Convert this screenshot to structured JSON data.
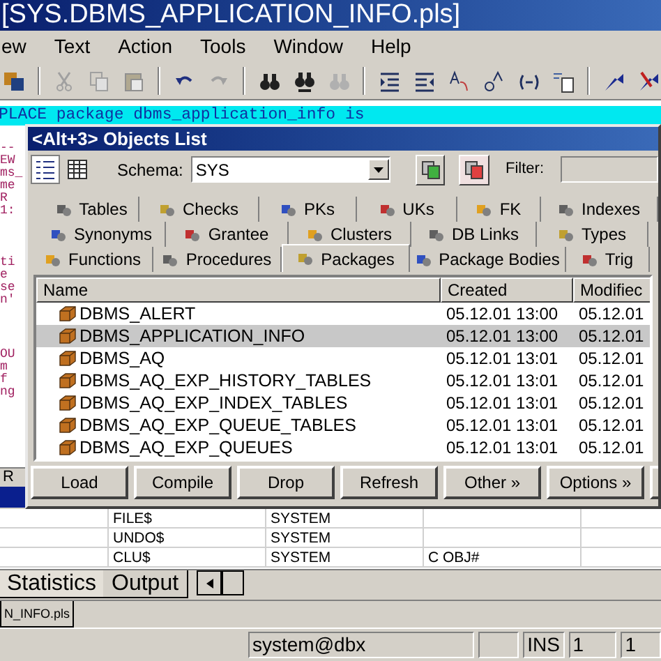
{
  "window": {
    "title": "[SYS.DBMS_APPLICATION_INFO.pls]"
  },
  "menu": [
    "ew",
    "Text",
    "Action",
    "Tools",
    "Window",
    "Help"
  ],
  "editor": {
    "current_line": "PLACE package dbms_application_info is",
    "fragments": [
      "--",
      "EW",
      "ms_",
      "me",
      "R",
      "1:",
      "ti",
      "e",
      "se",
      "n'",
      "OU",
      "m",
      "f",
      "ng"
    ]
  },
  "side_panel": {
    "label": "R"
  },
  "objects_list": {
    "title": "<Alt+3> Objects List",
    "schema_label": "Schema:",
    "schema_value": "SYS",
    "filter_label": "Filter:",
    "tab_rows": [
      [
        {
          "label": "Tables",
          "selected": false
        },
        {
          "label": "Checks",
          "selected": false
        },
        {
          "label": "PKs",
          "selected": false
        },
        {
          "label": "UKs",
          "selected": false
        },
        {
          "label": "FK",
          "selected": false
        },
        {
          "label": "Indexes",
          "selected": false
        }
      ],
      [
        {
          "label": "Synonyms",
          "selected": false
        },
        {
          "label": "Grantee",
          "selected": false
        },
        {
          "label": "Clusters",
          "selected": false
        },
        {
          "label": "DB Links",
          "selected": false
        },
        {
          "label": "Types",
          "selected": false
        }
      ],
      [
        {
          "label": "Functions",
          "selected": false
        },
        {
          "label": "Procedures",
          "selected": false
        },
        {
          "label": "Packages",
          "selected": true
        },
        {
          "label": "Package Bodies",
          "selected": false
        },
        {
          "label": "Trig",
          "selected": false
        }
      ]
    ],
    "columns": [
      "Name",
      "Created",
      "Modifiec"
    ],
    "rows": [
      {
        "name": "DBMS_ALERT",
        "created": "05.12.01 13:00",
        "modified": "05.12.01",
        "selected": false
      },
      {
        "name": "DBMS_APPLICATION_INFO",
        "created": "05.12.01 13:00",
        "modified": "05.12.01",
        "selected": true
      },
      {
        "name": "DBMS_AQ",
        "created": "05.12.01 13:01",
        "modified": "05.12.01",
        "selected": false
      },
      {
        "name": "DBMS_AQ_EXP_HISTORY_TABLES",
        "created": "05.12.01 13:01",
        "modified": "05.12.01",
        "selected": false
      },
      {
        "name": "DBMS_AQ_EXP_INDEX_TABLES",
        "created": "05.12.01 13:01",
        "modified": "05.12.01",
        "selected": false
      },
      {
        "name": "DBMS_AQ_EXP_QUEUE_TABLES",
        "created": "05.12.01 13:01",
        "modified": "05.12.01",
        "selected": false
      },
      {
        "name": "DBMS_AQ_EXP_QUEUES",
        "created": "05.12.01 13:01",
        "modified": "05.12.01",
        "selected": false
      }
    ],
    "buttons": [
      "Load",
      "Compile",
      "Drop",
      "Refresh",
      "Other »",
      "Options »"
    ]
  },
  "grid_rows": [
    [
      "FILE$",
      "SYSTEM",
      ""
    ],
    [
      "UNDO$",
      "SYSTEM",
      ""
    ],
    [
      "CLU$",
      "SYSTEM",
      "C OBJ#"
    ]
  ],
  "output_tabs": [
    {
      "label": "Statistics",
      "selected": false
    },
    {
      "label": "Output",
      "selected": true
    }
  ],
  "file_tab": "N_INFO.pls",
  "status_bar": {
    "connection": "system@dbx",
    "mode": "INS",
    "line": "1",
    "column": "1"
  }
}
